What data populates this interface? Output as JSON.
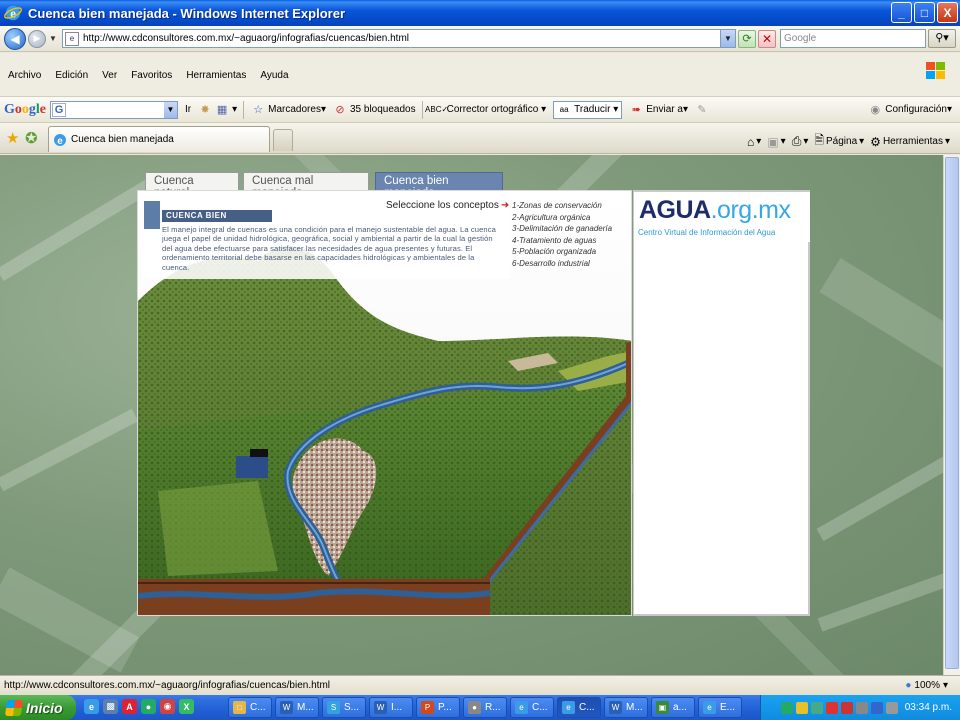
{
  "window": {
    "title": "Cuenca bien manejada - Windows Internet Explorer",
    "buttons": [
      "_",
      "□",
      "X"
    ]
  },
  "addressbar": {
    "url": "http://www.cdconsultores.com.mx/~aguaorg/infografias/cuencas/bien.html",
    "search_placeholder": "Google"
  },
  "menu": {
    "items": [
      "Archivo",
      "Edición",
      "Ver",
      "Favoritos",
      "Herramientas",
      "Ayuda"
    ]
  },
  "google_toolbar": {
    "logo": "Google",
    "go_label": "Ir",
    "bookmarks_label": "Marcadores",
    "blocked_label": "35 bloqueados",
    "spell_label": "Corrector ortográfico",
    "translate_label": "Traducir",
    "send_label": "Enviar a",
    "settings_label": "Configuración"
  },
  "tabs": {
    "active_tab": "Cuenca bien manejada"
  },
  "commands": {
    "page_label": "Página",
    "tools_label": "Herramientas"
  },
  "flash": {
    "tabs": [
      "Cuenca natural",
      "Cuenca mal manejada",
      "Cuenca bien manejada"
    ],
    "section_title": "CUENCA BIEN MANEJADA",
    "description": "El manejo integral de cuencas es una condición para el manejo sustentable del agua. La cuenca juega el papel de unidad hidrológica, geográfica, social y ambiental a partir de la cual la gestión del agua debe efectuarse para satisfacer las necesidades de agua presentes y futuras. El ordenamiento territorial debe basarse en las capacidades hidrológicas y ambientales de la cuenca.",
    "select_label": "Seleccione los conceptos",
    "concepts": [
      "1-Zonas de conservación",
      "2-Agricultura orgánica",
      "3-Delimitación de ganadería",
      "4-Tratamiento de aguas",
      "5-Población organizada",
      "6-Desarrollo industrial"
    ],
    "logo_main": "AGUA",
    "logo_domain": ".org.mx",
    "logo_sub": "Centro Virtual de Información del Agua"
  },
  "statusbar": {
    "url": "http://www.cdconsultores.com.mx/~aguaorg/infografias/cuencas/bien.html",
    "zoom": "100%"
  },
  "taskbar": {
    "start_label": "Inicio",
    "tasks": [
      "C...",
      "M...",
      "S...",
      "I...",
      "P...",
      "R...",
      "C...",
      "C...",
      "M...",
      "a...",
      "E..."
    ],
    "clock": "03:34 p.m."
  },
  "colors": {
    "xp_blue": "#0A55D8",
    "active_tab": "#6A86B0",
    "logo_dark": "#1D2D6A",
    "logo_light": "#35A8E3"
  }
}
